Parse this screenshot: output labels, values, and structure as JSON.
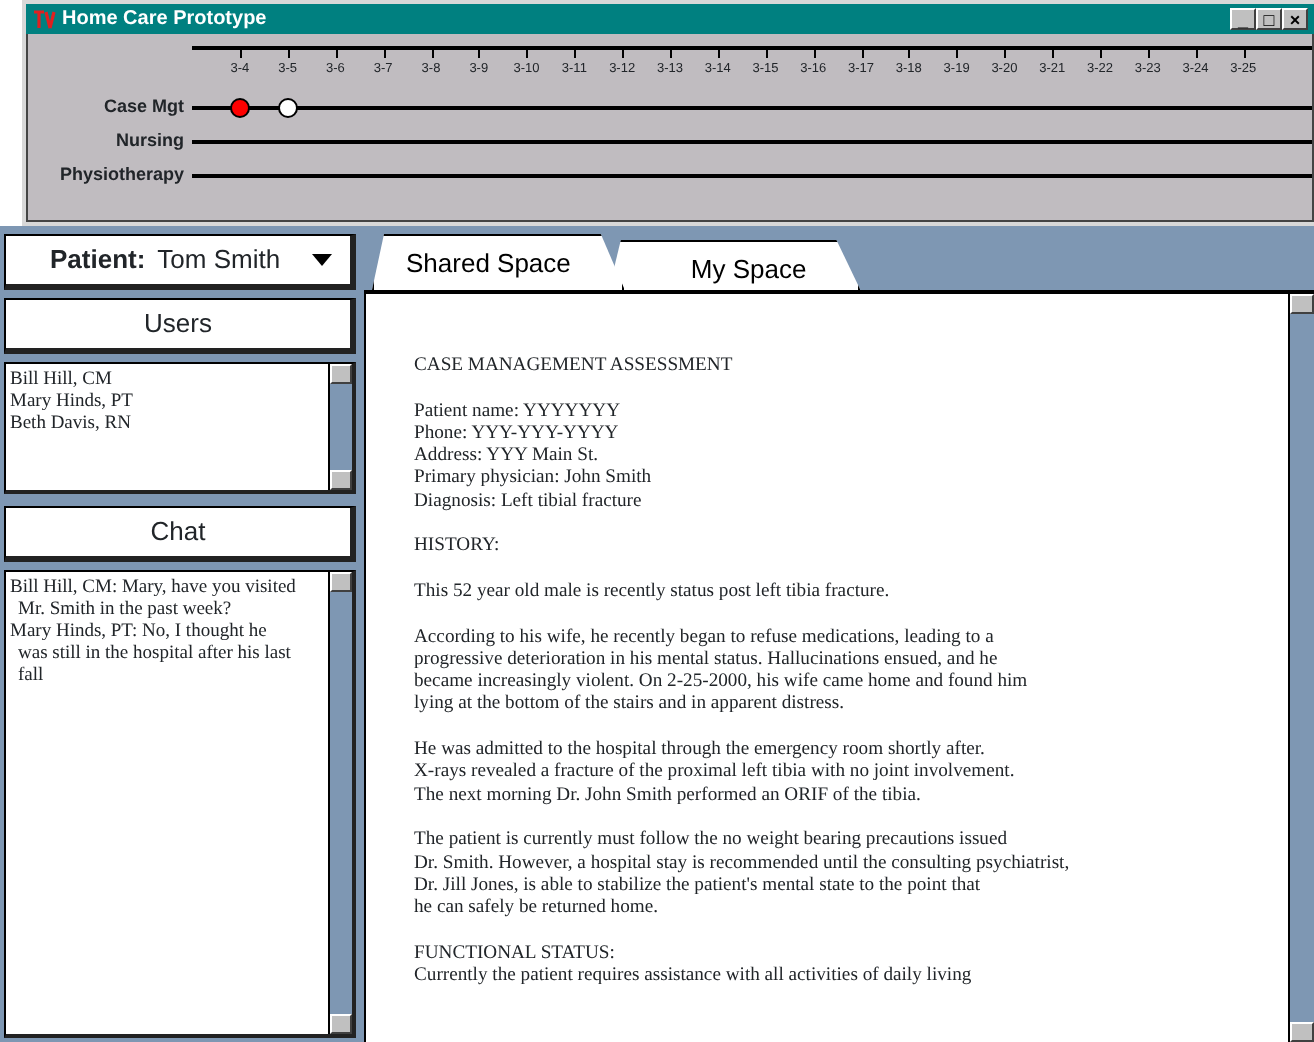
{
  "window": {
    "title": "Home Care Prototype",
    "controls": [
      "_",
      "□",
      "×"
    ]
  },
  "timeline": {
    "ticks": [
      "3-4",
      "3-5",
      "3-6",
      "3-7",
      "3-8",
      "3-9",
      "3-10",
      "3-11",
      "3-12",
      "3-13",
      "3-14",
      "3-15",
      "3-16",
      "3-17",
      "3-18",
      "3-19",
      "3-20",
      "3-21",
      "3-22",
      "3-23",
      "3-24",
      "3-25"
    ],
    "tracks": [
      {
        "label": "Case Mgt",
        "markers": [
          {
            "color": "#ff0000"
          },
          {
            "color": "#ffffff"
          }
        ]
      },
      {
        "label": "Nursing"
      },
      {
        "label": "Physiotherapy"
      }
    ]
  },
  "patient": {
    "label": "Patient:",
    "value": "Tom Smith"
  },
  "users": {
    "title": "Users",
    "items": [
      "Bill Hill, CM",
      "Mary Hinds, PT",
      "Beth Davis, RN"
    ]
  },
  "chat": {
    "title": "Chat",
    "messages": [
      "Bill Hill, CM: Mary, have you visited Mr. Smith in the past week?",
      "Mary Hinds, PT: No, I thought he was still in the hospital after his last fall"
    ]
  },
  "tabs": [
    {
      "label": "Shared Space",
      "selected": true
    },
    {
      "label": "My Space",
      "selected": false
    }
  ],
  "document": {
    "paragraphs": [
      "CASE MANAGEMENT ASSESSMENT",
      "Patient name: YYYYYYY\nPhone: YYY-YYY-YYYY\nAddress: YYY Main St.\nPrimary physician: John Smith\nDiagnosis: Left tibial fracture",
      "HISTORY:",
      "This 52 year old male is recently status post left tibia fracture.",
      "According to his wife, he recently began to refuse medications, leading to a\nprogressive deterioration in his mental status.  Hallucinations ensued, and he\nbecame increasingly violent.  On 2-25-2000, his wife came home and found him\nlying at the bottom of the stairs and in apparent distress.",
      "He was admitted to the hospital through the emergency room shortly after.\nX-rays revealed a fracture of the proximal left tibia with no joint involvement.\nThe next morning Dr. John Smith performed an ORIF of the tibia.",
      "The patient is currently must follow the no weight bearing precautions issued\nDr. Smith.  However, a hospital stay is recommended until the consulting psychiatrist,\nDr. Jill Jones, is able to stabilize the patient's mental state to the point that\nhe can safely be returned home.",
      "FUNCTIONAL STATUS:\nCurrently the patient requires assistance with all activities of daily living"
    ]
  }
}
